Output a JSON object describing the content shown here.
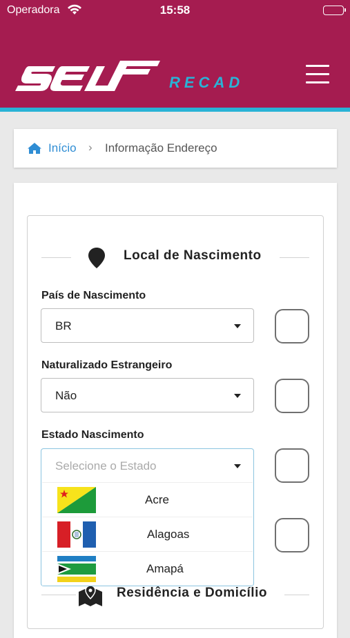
{
  "status_bar": {
    "carrier": "Operadora",
    "time": "15:58"
  },
  "header": {
    "logo_text": "SELF",
    "logo_subtitle": "RECAD"
  },
  "breadcrumb": {
    "home": "Início",
    "separator": "›",
    "current": "Informação Endereço"
  },
  "section_birth": {
    "title": "Local de Nascimento"
  },
  "fields": {
    "country": {
      "label": "País de Nascimento",
      "value": "BR"
    },
    "naturalized": {
      "label": "Naturalizado Estrangeiro",
      "value": "Não"
    },
    "state": {
      "label": "Estado Nascimento",
      "placeholder": "Selecione o Estado"
    }
  },
  "state_options": [
    "Acre",
    "Alagoas",
    "Amapá"
  ],
  "section_residence": {
    "title": "Residência e Domicílio"
  },
  "colors": {
    "brand": "#a51c50",
    "accent": "#29b3d6",
    "link": "#2f8dd4"
  }
}
